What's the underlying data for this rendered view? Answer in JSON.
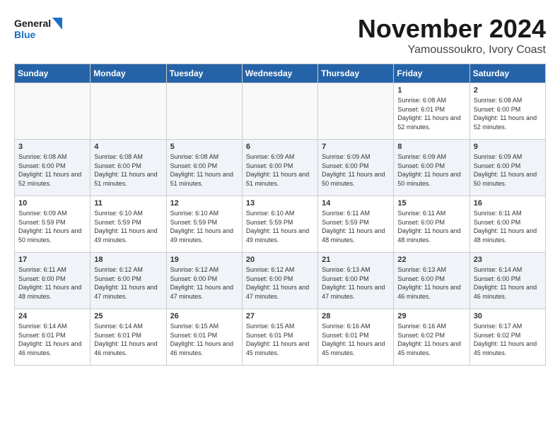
{
  "logo": {
    "line1": "General",
    "line2": "Blue"
  },
  "title": "November 2024",
  "subtitle": "Yamoussoukro, Ivory Coast",
  "days_of_week": [
    "Sunday",
    "Monday",
    "Tuesday",
    "Wednesday",
    "Thursday",
    "Friday",
    "Saturday"
  ],
  "weeks": [
    [
      {
        "day": "",
        "info": ""
      },
      {
        "day": "",
        "info": ""
      },
      {
        "day": "",
        "info": ""
      },
      {
        "day": "",
        "info": ""
      },
      {
        "day": "",
        "info": ""
      },
      {
        "day": "1",
        "info": "Sunrise: 6:08 AM\nSunset: 6:01 PM\nDaylight: 11 hours and 52 minutes."
      },
      {
        "day": "2",
        "info": "Sunrise: 6:08 AM\nSunset: 6:00 PM\nDaylight: 11 hours and 52 minutes."
      }
    ],
    [
      {
        "day": "3",
        "info": "Sunrise: 6:08 AM\nSunset: 6:00 PM\nDaylight: 11 hours and 52 minutes."
      },
      {
        "day": "4",
        "info": "Sunrise: 6:08 AM\nSunset: 6:00 PM\nDaylight: 11 hours and 51 minutes."
      },
      {
        "day": "5",
        "info": "Sunrise: 6:08 AM\nSunset: 6:00 PM\nDaylight: 11 hours and 51 minutes."
      },
      {
        "day": "6",
        "info": "Sunrise: 6:09 AM\nSunset: 6:00 PM\nDaylight: 11 hours and 51 minutes."
      },
      {
        "day": "7",
        "info": "Sunrise: 6:09 AM\nSunset: 6:00 PM\nDaylight: 11 hours and 50 minutes."
      },
      {
        "day": "8",
        "info": "Sunrise: 6:09 AM\nSunset: 6:00 PM\nDaylight: 11 hours and 50 minutes."
      },
      {
        "day": "9",
        "info": "Sunrise: 6:09 AM\nSunset: 6:00 PM\nDaylight: 11 hours and 50 minutes."
      }
    ],
    [
      {
        "day": "10",
        "info": "Sunrise: 6:09 AM\nSunset: 5:59 PM\nDaylight: 11 hours and 50 minutes."
      },
      {
        "day": "11",
        "info": "Sunrise: 6:10 AM\nSunset: 5:59 PM\nDaylight: 11 hours and 49 minutes."
      },
      {
        "day": "12",
        "info": "Sunrise: 6:10 AM\nSunset: 5:59 PM\nDaylight: 11 hours and 49 minutes."
      },
      {
        "day": "13",
        "info": "Sunrise: 6:10 AM\nSunset: 5:59 PM\nDaylight: 11 hours and 49 minutes."
      },
      {
        "day": "14",
        "info": "Sunrise: 6:11 AM\nSunset: 5:59 PM\nDaylight: 11 hours and 48 minutes."
      },
      {
        "day": "15",
        "info": "Sunrise: 6:11 AM\nSunset: 6:00 PM\nDaylight: 11 hours and 48 minutes."
      },
      {
        "day": "16",
        "info": "Sunrise: 6:11 AM\nSunset: 6:00 PM\nDaylight: 11 hours and 48 minutes."
      }
    ],
    [
      {
        "day": "17",
        "info": "Sunrise: 6:11 AM\nSunset: 6:00 PM\nDaylight: 11 hours and 48 minutes."
      },
      {
        "day": "18",
        "info": "Sunrise: 6:12 AM\nSunset: 6:00 PM\nDaylight: 11 hours and 47 minutes."
      },
      {
        "day": "19",
        "info": "Sunrise: 6:12 AM\nSunset: 6:00 PM\nDaylight: 11 hours and 47 minutes."
      },
      {
        "day": "20",
        "info": "Sunrise: 6:12 AM\nSunset: 6:00 PM\nDaylight: 11 hours and 47 minutes."
      },
      {
        "day": "21",
        "info": "Sunrise: 6:13 AM\nSunset: 6:00 PM\nDaylight: 11 hours and 47 minutes."
      },
      {
        "day": "22",
        "info": "Sunrise: 6:13 AM\nSunset: 6:00 PM\nDaylight: 11 hours and 46 minutes."
      },
      {
        "day": "23",
        "info": "Sunrise: 6:14 AM\nSunset: 6:00 PM\nDaylight: 11 hours and 46 minutes."
      }
    ],
    [
      {
        "day": "24",
        "info": "Sunrise: 6:14 AM\nSunset: 6:01 PM\nDaylight: 11 hours and 46 minutes."
      },
      {
        "day": "25",
        "info": "Sunrise: 6:14 AM\nSunset: 6:01 PM\nDaylight: 11 hours and 46 minutes."
      },
      {
        "day": "26",
        "info": "Sunrise: 6:15 AM\nSunset: 6:01 PM\nDaylight: 11 hours and 46 minutes."
      },
      {
        "day": "27",
        "info": "Sunrise: 6:15 AM\nSunset: 6:01 PM\nDaylight: 11 hours and 45 minutes."
      },
      {
        "day": "28",
        "info": "Sunrise: 6:16 AM\nSunset: 6:01 PM\nDaylight: 11 hours and 45 minutes."
      },
      {
        "day": "29",
        "info": "Sunrise: 6:16 AM\nSunset: 6:02 PM\nDaylight: 11 hours and 45 minutes."
      },
      {
        "day": "30",
        "info": "Sunrise: 6:17 AM\nSunset: 6:02 PM\nDaylight: 11 hours and 45 minutes."
      }
    ]
  ]
}
